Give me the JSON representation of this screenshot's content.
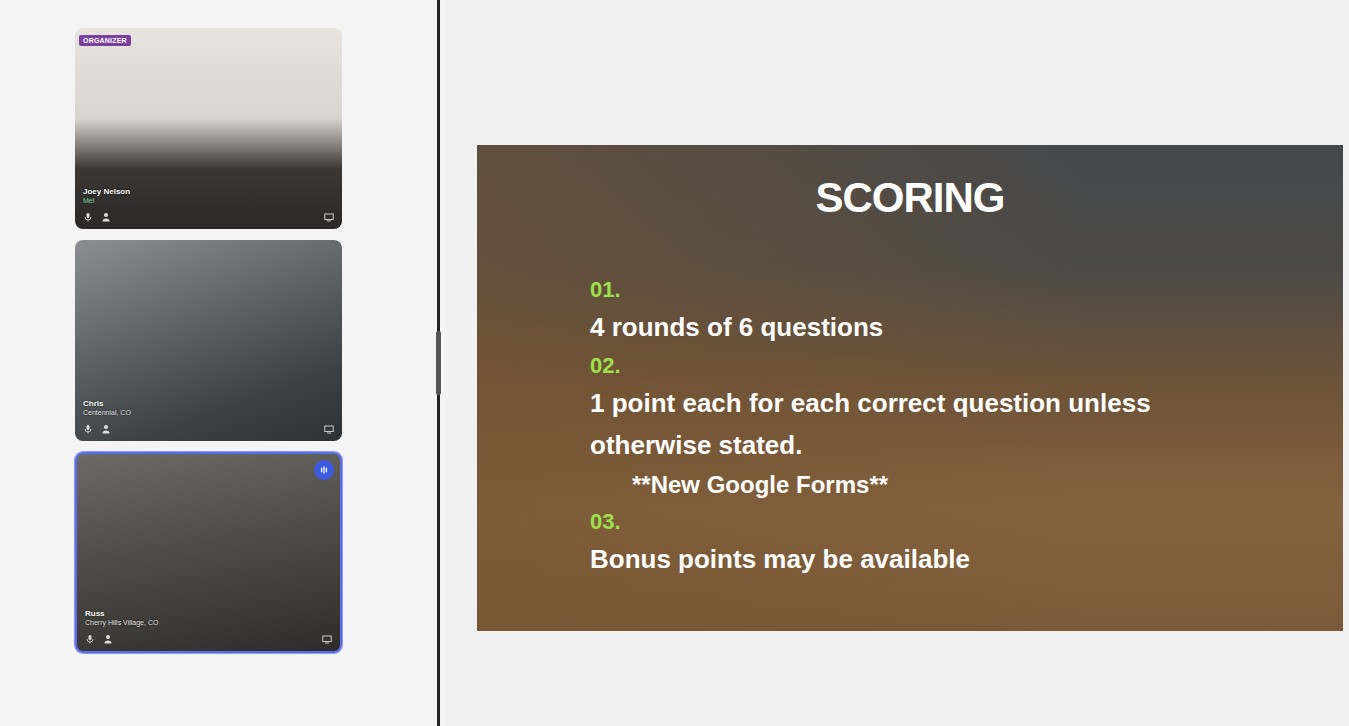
{
  "participants": [
    {
      "name": "Joey Nelson",
      "location": "Mel",
      "badge": "ORGANIZER",
      "speaking": false
    },
    {
      "name": "Chris",
      "location": "Centennial, CO",
      "speaking": false
    },
    {
      "name": "Russ",
      "location": "Cherry Hills Village, CO",
      "speaking": true
    }
  ],
  "slide": {
    "title": "SCORING",
    "items": [
      {
        "number": "01.",
        "text": "4 rounds of 6 questions"
      },
      {
        "number": "02.",
        "text": "1 point each for each correct question unless otherwise stated.",
        "note": "**New Google Forms**"
      },
      {
        "number": "03.",
        "text": "Bonus points may be available"
      }
    ]
  }
}
